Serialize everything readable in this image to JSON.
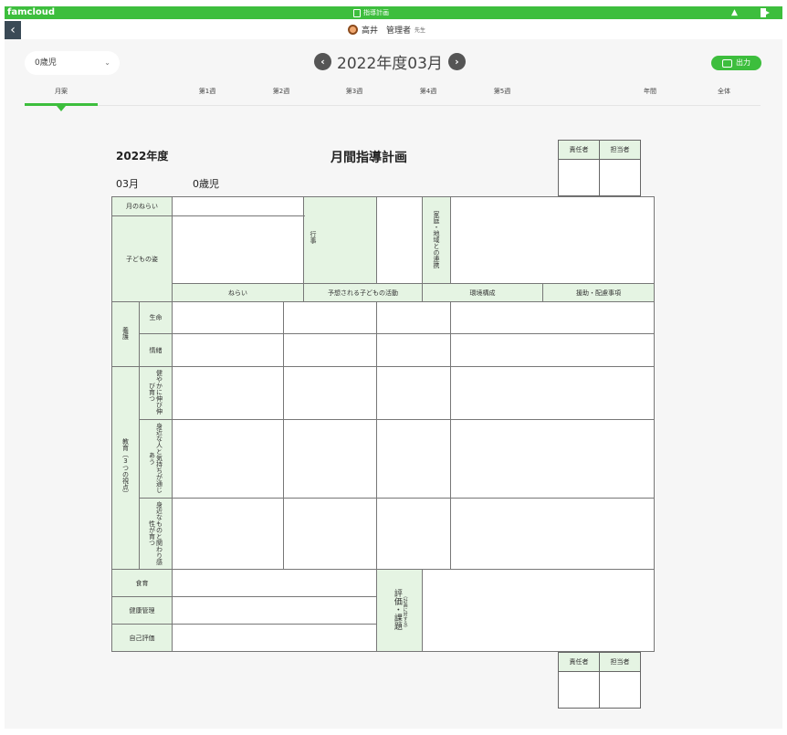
{
  "app": {
    "brand": "famcloud",
    "page_title": "指導計画"
  },
  "user": {
    "name": "高井　管理者",
    "suffix": "先生"
  },
  "toolbar": {
    "age_select": "0歳児",
    "period": "2022年度03月",
    "print_label": "出力"
  },
  "tabs": [
    "月案",
    "第1週",
    "第2週",
    "第3週",
    "第4週",
    "第5週",
    "年間",
    "全体"
  ],
  "document": {
    "year": "2022年度",
    "title": "月間指導計画",
    "month": "03月",
    "age": "0歳児",
    "sign_headers": [
      "責任者",
      "担当者"
    ]
  },
  "plan": {
    "monthly_aim": "月のねらい",
    "child_state": "子どもの姿",
    "events": "行事",
    "family_link": "家庭・地域との連携",
    "columns": [
      "ねらい",
      "予想される子どもの活動",
      "環境構成",
      "援助・配慮事項"
    ],
    "nursing": "養護",
    "life": "生命",
    "emotion": "情緒",
    "education": "教育（3つの視点）",
    "view1": "健やかに伸び伸び育つ",
    "view2": "身近な人と気持ちが通じあう",
    "view3": "身近なものと関わり感性が育つ",
    "diet": "食育",
    "health": "健康管理",
    "self_eval": "自己評価",
    "evaluation": "評価・課題",
    "evaluation_note": "（計画に対する）"
  },
  "colors": {
    "accent": "#3dbe3d",
    "cell_header": "#e5f4e3"
  }
}
